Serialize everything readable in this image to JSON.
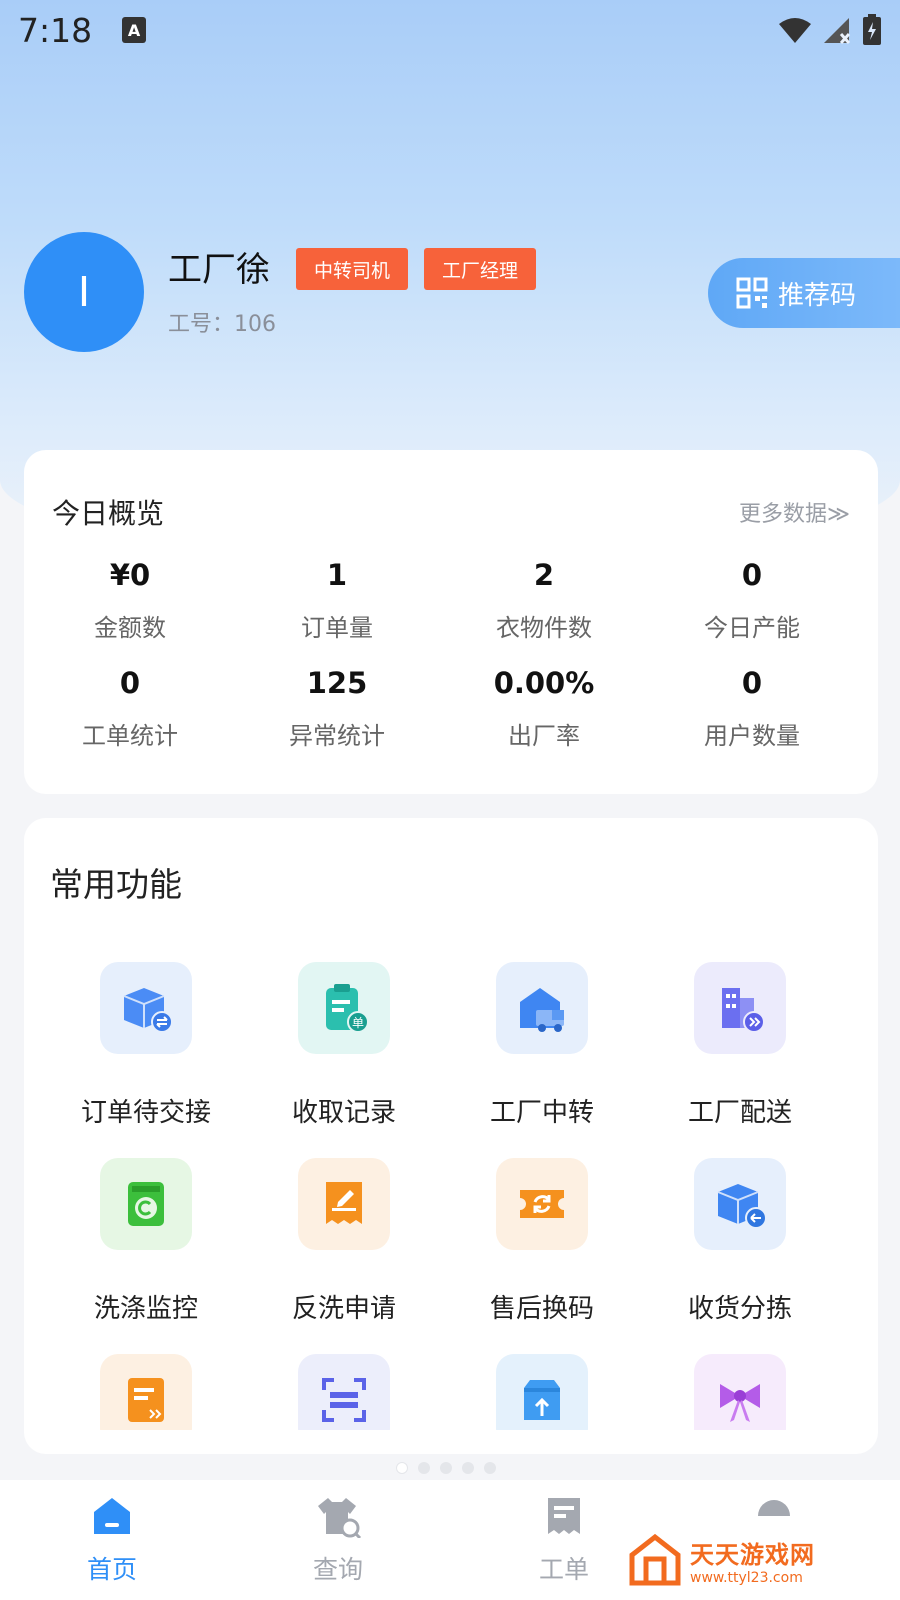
{
  "status_bar": {
    "time": "7:18",
    "a_badge": "A"
  },
  "profile": {
    "avatar_letter": "I",
    "name": "工厂徐",
    "roles": [
      "中转司机",
      "工厂经理"
    ],
    "employee_id": "工号：106",
    "referral_label": "推荐码"
  },
  "overview": {
    "title": "今日概览",
    "more": "更多数据≫",
    "stats": [
      {
        "value": "¥0",
        "label": "金额数"
      },
      {
        "value": "1",
        "label": "订单量"
      },
      {
        "value": "2",
        "label": "衣物件数"
      },
      {
        "value": "0",
        "label": "今日产能"
      },
      {
        "value": "0",
        "label": "工单统计"
      },
      {
        "value": "125",
        "label": "异常统计"
      },
      {
        "value": "0.00%",
        "label": "出厂率"
      },
      {
        "value": "0",
        "label": "用户数量"
      }
    ]
  },
  "functions": {
    "title": "常用功能",
    "items": [
      {
        "label": "订单待交接",
        "icon": "box-handover-icon",
        "color": "#4b8cf5"
      },
      {
        "label": "收取记录",
        "icon": "clipboard-icon",
        "color": "#2bbfae"
      },
      {
        "label": "工厂中转",
        "icon": "warehouse-truck-icon",
        "color": "#3f86f2"
      },
      {
        "label": "工厂配送",
        "icon": "building-delivery-icon",
        "color": "#6b6ff0"
      },
      {
        "label": "洗涤监控",
        "icon": "washing-machine-icon",
        "color": "#3cbf3c"
      },
      {
        "label": "反洗申请",
        "icon": "receipt-edit-icon",
        "color": "#f5911e"
      },
      {
        "label": "售后换码",
        "icon": "ticket-exchange-icon",
        "color": "#f5911e"
      },
      {
        "label": "收货分拣",
        "icon": "box-receive-icon",
        "color": "#3f86f2"
      },
      {
        "label": "",
        "icon": "document-forward-icon",
        "color": "#f5911e"
      },
      {
        "label": "",
        "icon": "scan-icon",
        "color": "#5b63e8"
      },
      {
        "label": "",
        "icon": "upload-box-icon",
        "color": "#3f9cf2"
      },
      {
        "label": "",
        "icon": "gift-bow-icon",
        "color": "#b45ce8"
      }
    ]
  },
  "bottom_nav": {
    "items": [
      {
        "label": "首页",
        "icon": "home-icon"
      },
      {
        "label": "查询",
        "icon": "shirt-search-icon"
      },
      {
        "label": "工单",
        "icon": "ticket-icon"
      },
      {
        "label": "",
        "icon": "profile-icon"
      }
    ],
    "active_color": "#2f8ff7",
    "inactive_color": "#a4a8b0"
  },
  "watermark": {
    "name": "天天游戏网",
    "url": "www.ttyl23.com"
  }
}
